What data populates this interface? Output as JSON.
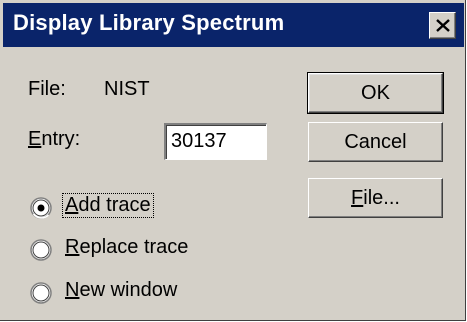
{
  "window": {
    "title": "Display Library Spectrum",
    "close_symbol": "✕"
  },
  "fields": {
    "file_label": "File:",
    "file_value": "NIST",
    "entry_label_prefix": "E",
    "entry_label_rest": "ntry:",
    "entry_value": "30137"
  },
  "buttons": {
    "ok": "OK",
    "cancel": "Cancel",
    "file_prefix": "F",
    "file_rest": "ile..."
  },
  "radios": [
    {
      "prefix": "A",
      "rest": "dd trace",
      "checked": true,
      "focused": true
    },
    {
      "prefix": "R",
      "rest": "eplace trace",
      "checked": false,
      "focused": false
    },
    {
      "prefix": "N",
      "rest": "ew window",
      "checked": false,
      "focused": false
    }
  ]
}
